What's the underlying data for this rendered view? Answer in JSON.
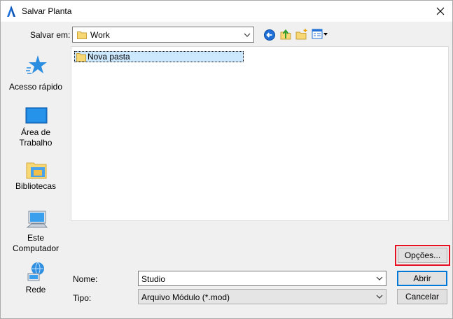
{
  "window": {
    "title": "Salvar Planta",
    "icon": "archicad-app-icon"
  },
  "toolbar": {
    "save_in_label": "Salvar em:",
    "location": "Work",
    "buttons": [
      "back-icon",
      "up-folder-icon",
      "new-folder-icon",
      "view-menu-icon"
    ]
  },
  "places": [
    {
      "label": "Acesso rápido",
      "icon": "star-icon"
    },
    {
      "label": "Área de Trabalho",
      "icon": "desktop-icon"
    },
    {
      "label": "Bibliotecas",
      "icon": "libraries-icon"
    },
    {
      "label": "Este Computador",
      "icon": "computer-icon"
    },
    {
      "label": "Rede",
      "icon": "network-icon"
    }
  ],
  "files": [
    {
      "name": "Nova pasta",
      "type": "folder",
      "selected": true
    }
  ],
  "form": {
    "name_label": "Nome:",
    "name_value": "Studio",
    "type_label": "Tipo:",
    "type_value": "Arquivo Módulo (*.mod)"
  },
  "buttons": {
    "options": "Opções...",
    "open": "Abrir",
    "cancel": "Cancelar"
  },
  "colors": {
    "selection": "#cce8ff",
    "default_button_border": "#0078d7",
    "highlight": "#e81123",
    "folder": "#f8d775"
  }
}
